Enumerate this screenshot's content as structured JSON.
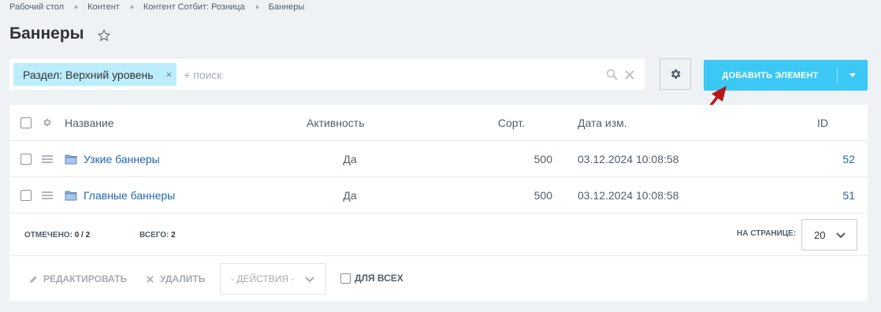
{
  "breadcrumb": [
    "Рабочий стол",
    "Контент",
    "Контент Сотбит: Розница",
    "Баннеры"
  ],
  "page_title": "Баннеры",
  "filter": {
    "chip_label": "Раздел: Верхний уровень",
    "chip_close": "×",
    "search_placeholder": "+ поиск"
  },
  "add_button": {
    "label": "ДОБАВИТЬ ЭЛЕМЕНТ"
  },
  "accent_color": "#3bc8f5",
  "table": {
    "columns": {
      "name": "Название",
      "active": "Активность",
      "sort": "Сорт.",
      "date": "Дата изм.",
      "id": "ID"
    },
    "rows": [
      {
        "name": "Узкие баннеры",
        "active": "Да",
        "sort": "500",
        "date": "03.12.2024 10:08:58",
        "id": "52"
      },
      {
        "name": "Главные баннеры",
        "active": "Да",
        "sort": "500",
        "date": "03.12.2024 10:08:58",
        "id": "51"
      }
    ]
  },
  "footer": {
    "selected_label": "ОТМЕЧЕНО:",
    "selected_value": "0 / 2",
    "total_label": "ВСЕГО:",
    "total_value": "2",
    "per_page_label": "НА СТРАНИЦЕ:",
    "per_page_value": "20"
  },
  "actions": {
    "edit": "РЕДАКТИРОВАТЬ",
    "delete": "УДАЛИТЬ",
    "select_placeholder": "- ДЕЙСТВИЯ -",
    "for_all": "ДЛЯ ВСЕХ"
  }
}
